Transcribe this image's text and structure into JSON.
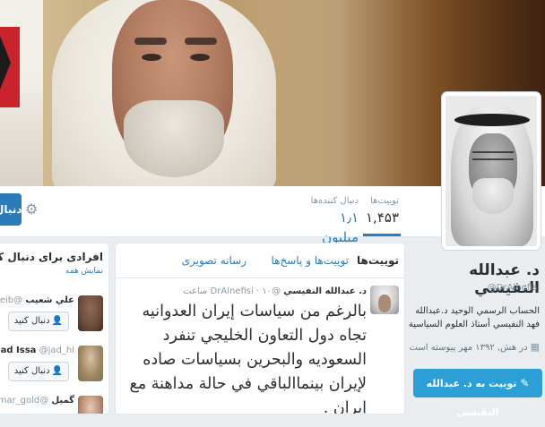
{
  "profile": {
    "name": "د. عبدالله النفيسي",
    "handle": "@DrAlnefisi",
    "bio": "الحساب الرسمي الوحيد د.عبدالله فهد النفيسي أستاذ العلوم السياسية",
    "joined": "در هش, ۱۳۹۲ مهر پیوسته است",
    "tweet_to_button": "توییت به د. عبدالله النفیسی"
  },
  "stats": {
    "tweets_label": "توییت‌ها",
    "tweets_value": "۱,۴۵۳",
    "following_label": "دنبال کننده‌ها",
    "following_value": "۱٫۱ میلیون"
  },
  "header": {
    "follow_button": "دنبال"
  },
  "timeline": {
    "tabs": [
      {
        "label": "توییت‌ها"
      },
      {
        "label": "توییت‌ها و پاسخ‌ها"
      },
      {
        "label": "رسانه تصویری"
      }
    ],
    "tweet": {
      "name": "د. عبدالله النفيسي",
      "handle": "@DrAlnefisi",
      "time": "۱۰ ساعت",
      "text": "بالرغم من سياسات إيران العدوانيه تجاه دول التعاون الخليجي تنفرد السعوديه والبحرين بسياسات صاده لإيران بينماالباقي في حالة مداهنة مع إيران ."
    }
  },
  "who_to_follow": {
    "title": "افرادی برای دنبال کردن · به روز",
    "show_all": "نمایش همه",
    "suggestions": [
      {
        "name": "علي شعيب",
        "handle": "@ASheib",
        "button": "دنبال کنید"
      },
      {
        "name": "Jad Issa",
        "handle": "@jad_hl",
        "button": "دنبال کنید"
      },
      {
        "name": "گمیل",
        "handle": "@lamar_gold",
        "button": ""
      }
    ]
  }
}
